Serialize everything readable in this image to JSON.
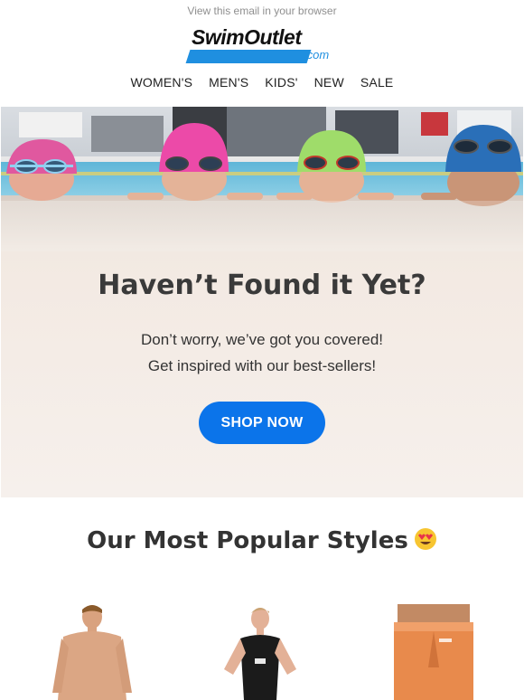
{
  "preheader": {
    "text": "View this email in your browser"
  },
  "logo": {
    "word": "SwimOutlet",
    "suffix": ".com"
  },
  "nav": {
    "items": [
      {
        "label": "WOMEN'S"
      },
      {
        "label": "MEN'S"
      },
      {
        "label": "KIDS'"
      },
      {
        "label": "NEW"
      },
      {
        "label": "SALE"
      }
    ]
  },
  "hero": {
    "title": "Haven’t Found it Yet?",
    "line1": "Don’t worry, we’ve got you covered!",
    "line2": "Get inspired with our best-sellers!",
    "cta": "SHOP NOW"
  },
  "popular": {
    "title": "Our Most Popular Styles",
    "emoji": "heart-eyes-emoji-icon"
  },
  "colors": {
    "accent": "#0b74ea",
    "brand_bar": "#1f8fe0",
    "hero_bg": "#f3eae3",
    "text": "#333333"
  }
}
